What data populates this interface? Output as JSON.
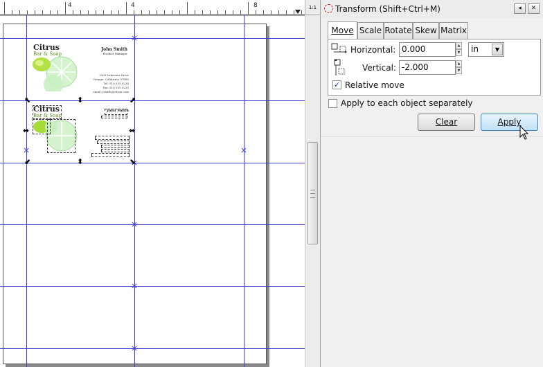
{
  "ruler": {
    "corner_label": "1:1",
    "tick_labels": [
      "4",
      "8"
    ]
  },
  "card1": {
    "brand": "Citrus",
    "tagline": "Bar & Soap",
    "name": "John Smith",
    "title": "Product Manager",
    "address_lines": [
      "1000 Lakeview Drive",
      "Orange, California 07680",
      "Tel. 510 555.0234",
      "Fax. 510 555.0235",
      "email. jsmith@citrus.com"
    ]
  },
  "card2": {
    "brand": "Citrus",
    "tagline": "Bar & Soap",
    "name": "John Smith"
  },
  "panel": {
    "title": "Transform (Shift+Ctrl+M)",
    "header_buttons": [
      "◂",
      "✕"
    ],
    "tabs": [
      {
        "label": "Move",
        "active": true
      },
      {
        "label": "Scale",
        "active": false
      },
      {
        "label": "Rotate",
        "active": false
      },
      {
        "label": "Skew",
        "active": false
      },
      {
        "label": "Matrix",
        "active": false
      }
    ],
    "horizontal_label": "Horizontal:",
    "horizontal_value": "0.000",
    "vertical_label": "Vertical:",
    "vertical_value": "-2.000",
    "unit": "in",
    "relative_move_label": "Relative move",
    "relative_move_checked": true,
    "apply_each_label": "Apply to each object separately",
    "apply_each_checked": false,
    "clear_label": "Clear",
    "apply_label": "Apply"
  },
  "colors": {
    "guide": "#3a3ad8",
    "accent_hover": "#bfe2f8",
    "lime": "#a6dc3a"
  }
}
